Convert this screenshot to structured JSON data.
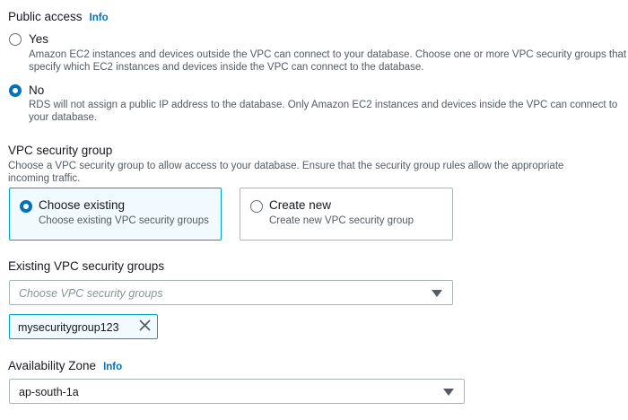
{
  "public_access": {
    "label": "Public access",
    "info": "Info",
    "options": [
      {
        "label": "Yes",
        "selected": false,
        "desc_line1": "Amazon EC2 instances and devices outside the VPC can connect to your database. Choose one or more VPC security groups that",
        "desc_line2": "specify which EC2 instances and devices inside the VPC can connect to the database."
      },
      {
        "label": "No",
        "selected": true,
        "desc_line1": "RDS will not assign a public IP address to the database. Only Amazon EC2 instances and devices inside the VPC can connect to",
        "desc_line2": "your database."
      }
    ]
  },
  "vpc_security_group": {
    "label": "VPC security group",
    "desc_line1": "Choose a VPC security group to allow access to your database. Ensure that the security group rules allow the appropriate",
    "desc_line2": "incoming traffic.",
    "cards": [
      {
        "title": "Choose existing",
        "desc": "Choose existing VPC security groups",
        "selected": true
      },
      {
        "title": "Create new",
        "desc": "Create new VPC security group",
        "selected": false
      }
    ]
  },
  "existing_groups": {
    "label": "Existing VPC security groups",
    "placeholder": "Choose VPC security groups",
    "tokens": [
      "mysecuritygroup123"
    ]
  },
  "availability_zone": {
    "label": "Availability Zone",
    "info": "Info",
    "value": "ap-south-1a"
  },
  "colors": {
    "link": "#0073bb",
    "selected_border": "#00a1c9",
    "selected_bg": "#f1faff",
    "text": "#16191f",
    "secondary_text": "#545b64"
  }
}
